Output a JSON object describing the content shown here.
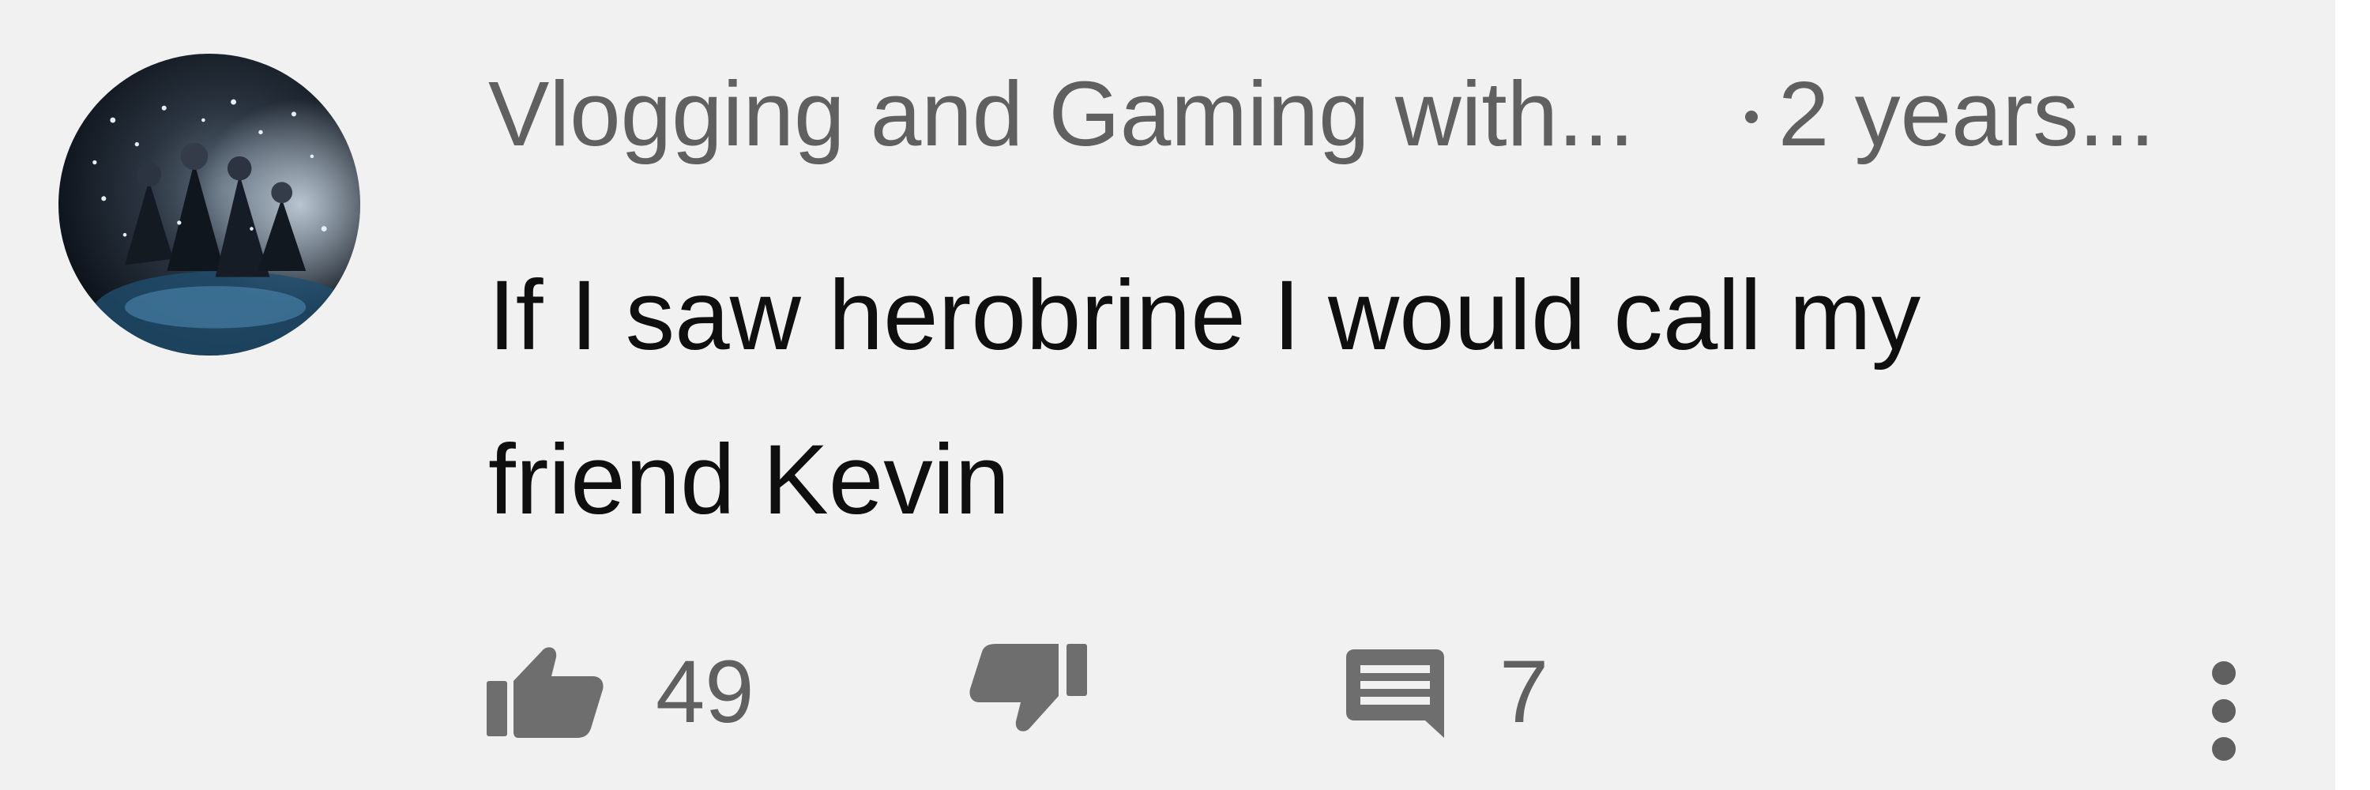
{
  "comment": {
    "author": "Vlogging and Gaming with...",
    "timestamp": "2 years...",
    "text_line1": "If I saw herobrine I would call my",
    "text_line2": "friend Kevin",
    "like_count": "49",
    "reply_count": "7"
  },
  "icons": {
    "like": "thumbs-up-icon",
    "dislike": "thumbs-down-icon",
    "replies": "reply-comment-icon",
    "more": "more-vertical-icon"
  },
  "colors": {
    "background": "#f1f1f1",
    "secondary_text": "#606060",
    "primary_text": "#0f0f0f",
    "icon": "#6e6e6e"
  }
}
